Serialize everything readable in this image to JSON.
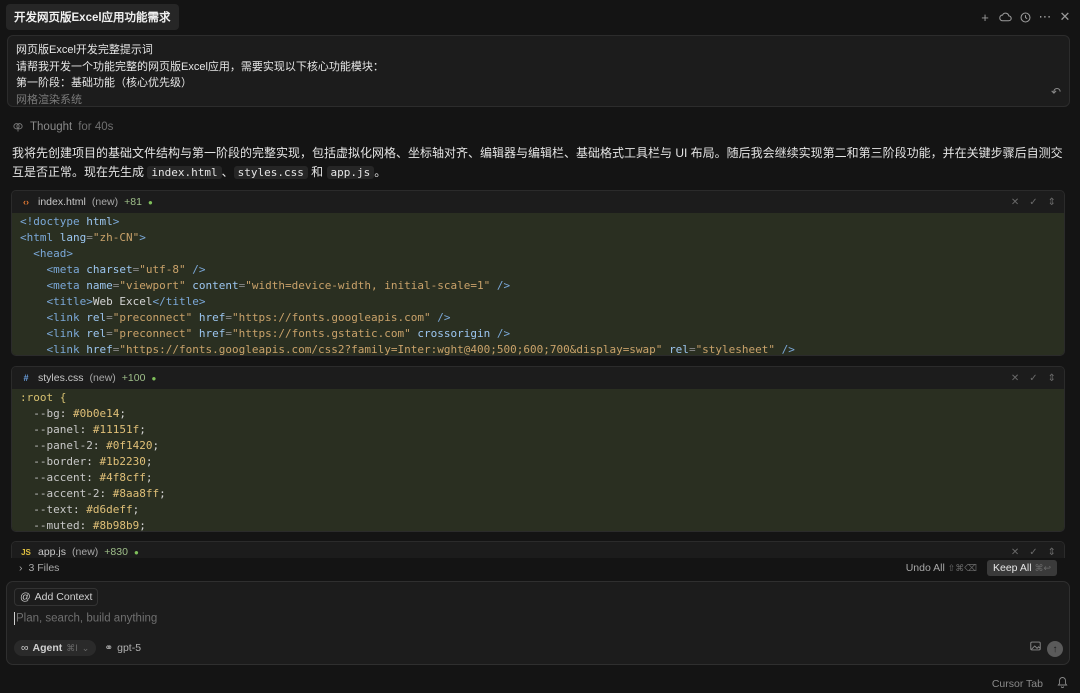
{
  "header": {
    "title": "开发网页版Excel应用功能需求",
    "icons": [
      "plus-icon",
      "cloud-icon",
      "history-icon",
      "more-icon",
      "close-icon"
    ]
  },
  "prompt": {
    "line1": "网页版Excel开发完整提示词",
    "line2": "请帮我开发一个功能完整的网页版Excel应用，需要实现以下核心功能模块：",
    "line3": "第一阶段：基础功能（核心优先级）",
    "line4": "网格渲染系统"
  },
  "thought": {
    "label": "Thought",
    "duration": "for 40s"
  },
  "message": {
    "text_a": "我将先创建项目的基础文件结构与第一阶段的完整实现，包括虚拟化网格、坐标轴对齐、编辑器与编辑栏、基础格式工具栏与 UI 布局。随后我会继续实现第二和第三阶段功能，并在关键步骤后自测交互是否正常。现在先生成 ",
    "file1": "index.html",
    "sep1": "、",
    "file2": "styles.css",
    "sep2": " 和 ",
    "file3": "app.js",
    "end": "。"
  },
  "files": [
    {
      "name": "index.html",
      "status": "(new)",
      "delta": "+81",
      "icon": "‹›"
    },
    {
      "name": "styles.css",
      "status": "(new)",
      "delta": "+100",
      "icon": "#"
    },
    {
      "name": "app.js",
      "status": "(new)",
      "delta": "+830",
      "icon": "JS"
    }
  ],
  "html_code": [
    "<!doctype html>",
    "<html lang=\"zh-CN\">",
    "  <head>",
    "    <meta charset=\"utf-8\" />",
    "    <meta name=\"viewport\" content=\"width=device-width, initial-scale=1\" />",
    "    <title>Web Excel</title>",
    "    <link rel=\"preconnect\" href=\"https://fonts.googleapis.com\" />",
    "    <link rel=\"preconnect\" href=\"https://fonts.gstatic.com\" crossorigin />",
    "    <link href=\"https://fonts.googleapis.com/css2?family=Inter:wght@400;500;600;700&display=swap\" rel=\"stylesheet\" />"
  ],
  "css_code": [
    ":root {",
    "  --bg: #0b0e14;",
    "  --panel: #11151f;",
    "  --panel-2: #0f1420;",
    "  --border: #1b2230;",
    "  --accent: #4f8cff;",
    "  --accent-2: #8aa8ff;",
    "  --text: #d6deff;",
    "  --muted: #8b98b9;"
  ],
  "files_bar": {
    "count_label": "3 Files",
    "undo_label": "Undo All",
    "undo_kbd": "⇧⌘⌫",
    "keep_label": "Keep All",
    "keep_kbd": "⌘↩"
  },
  "composer": {
    "add_context": "Add Context",
    "placeholder": "Plan, search, build anything",
    "agent_label": "Agent",
    "agent_kbd": "⌘I",
    "model": "gpt-5"
  },
  "status": {
    "label": "Cursor Tab"
  }
}
